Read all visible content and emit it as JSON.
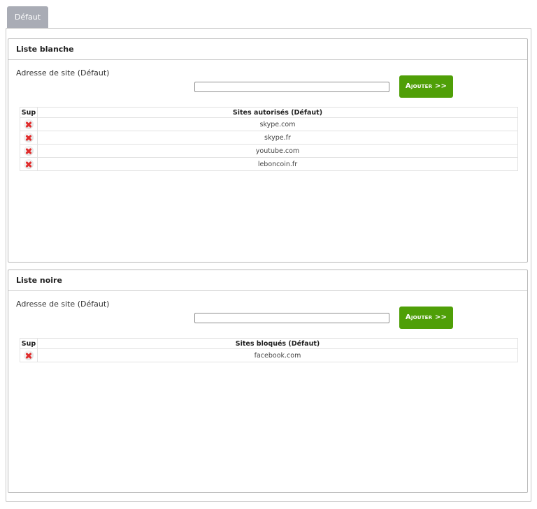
{
  "tab": {
    "label": "Défaut"
  },
  "whitelist": {
    "title": "Liste blanche",
    "address_label": "Adresse de site (Défaut)",
    "input_value": "",
    "add_button": "Ajouter >>",
    "columns": [
      "Sup",
      "Sites autorisés (Défaut)"
    ],
    "sites": [
      "skype.com",
      "skype.fr",
      "youtube.com",
      "leboncoin.fr"
    ]
  },
  "blacklist": {
    "title": "Liste noire",
    "address_label": "Adresse de site (Défaut)",
    "input_value": "",
    "add_button": "Ajouter >>",
    "columns": [
      "Sup",
      "Sites bloqués (Défaut)"
    ],
    "sites": [
      "facebook.com"
    ]
  },
  "colors": {
    "accent": "#4f9f07",
    "tab": "#a9acb5",
    "delete": "#e02b2b"
  },
  "icons": {
    "delete": "delete-icon"
  }
}
